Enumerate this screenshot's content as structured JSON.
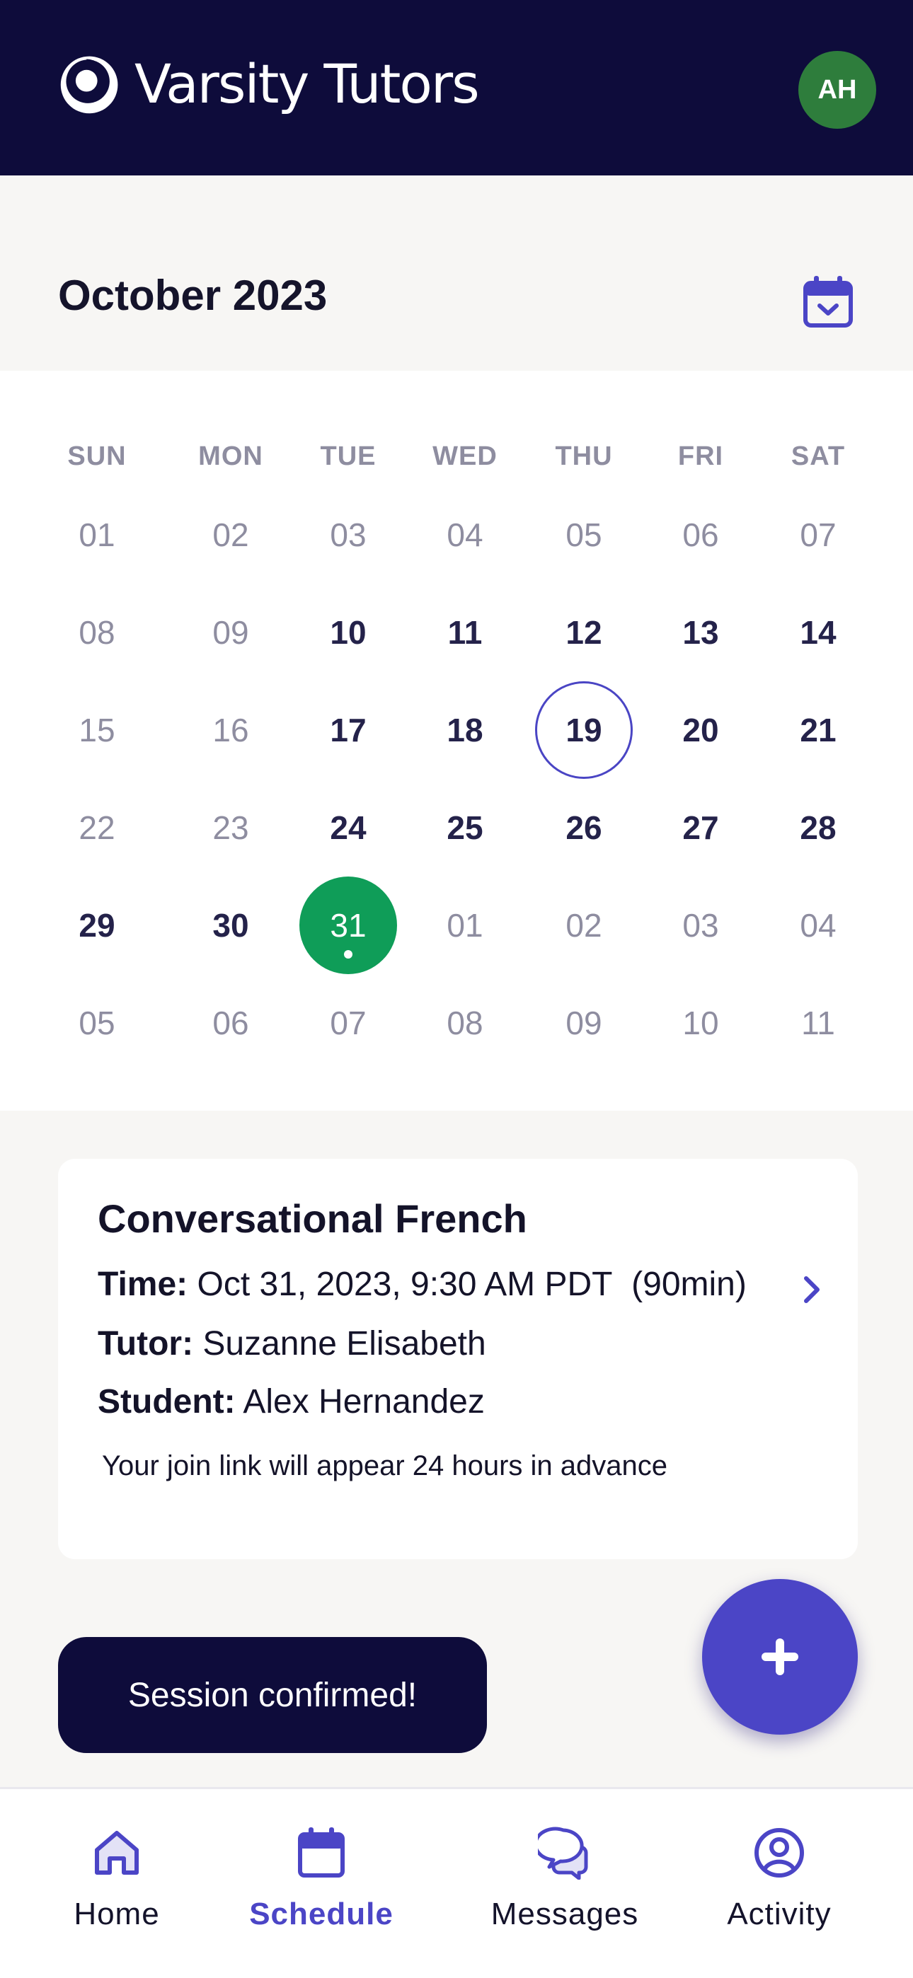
{
  "header": {
    "brand": "Varsity Tutors",
    "avatar_initials": "AH"
  },
  "calendar": {
    "month_title": "October 2023",
    "weekdays": [
      "SUN",
      "MON",
      "TUE",
      "WED",
      "THU",
      "FRI",
      "SAT"
    ],
    "weeks": [
      [
        "01",
        "02",
        "03",
        "04",
        "05",
        "06",
        "07"
      ],
      [
        "08",
        "09",
        "10",
        "11",
        "12",
        "13",
        "14"
      ],
      [
        "15",
        "16",
        "17",
        "18",
        "19",
        "20",
        "21"
      ],
      [
        "22",
        "23",
        "24",
        "25",
        "26",
        "27",
        "28"
      ],
      [
        "29",
        "30",
        "31",
        "01",
        "02",
        "03",
        "04"
      ],
      [
        "05",
        "06",
        "07",
        "08",
        "09",
        "10",
        "11"
      ]
    ],
    "today": "19",
    "selected": "31"
  },
  "session": {
    "title": "Conversational French",
    "time_label": "Time:",
    "time_value": "Oct 31, 2023, 9:30 AM PDT",
    "duration": "(90min)",
    "tutor_label": "Tutor:",
    "tutor_value": "Suzanne Elisabeth",
    "student_label": "Student:",
    "student_value": "Alex Hernandez",
    "note": "Your join link will appear 24 hours in advance"
  },
  "toast": {
    "message": "Session confirmed!"
  },
  "nav": {
    "items": [
      {
        "label": "Home",
        "icon": "home-icon"
      },
      {
        "label": "Schedule",
        "icon": "calendar-icon"
      },
      {
        "label": "Messages",
        "icon": "chat-icon"
      },
      {
        "label": "Activity",
        "icon": "user-circle-icon"
      }
    ],
    "active": "Schedule"
  },
  "colors": {
    "header_bg": "#0e0c3b",
    "accent": "#4b45c6",
    "selected_day": "#0f9d58",
    "avatar": "#2e7d3c"
  }
}
